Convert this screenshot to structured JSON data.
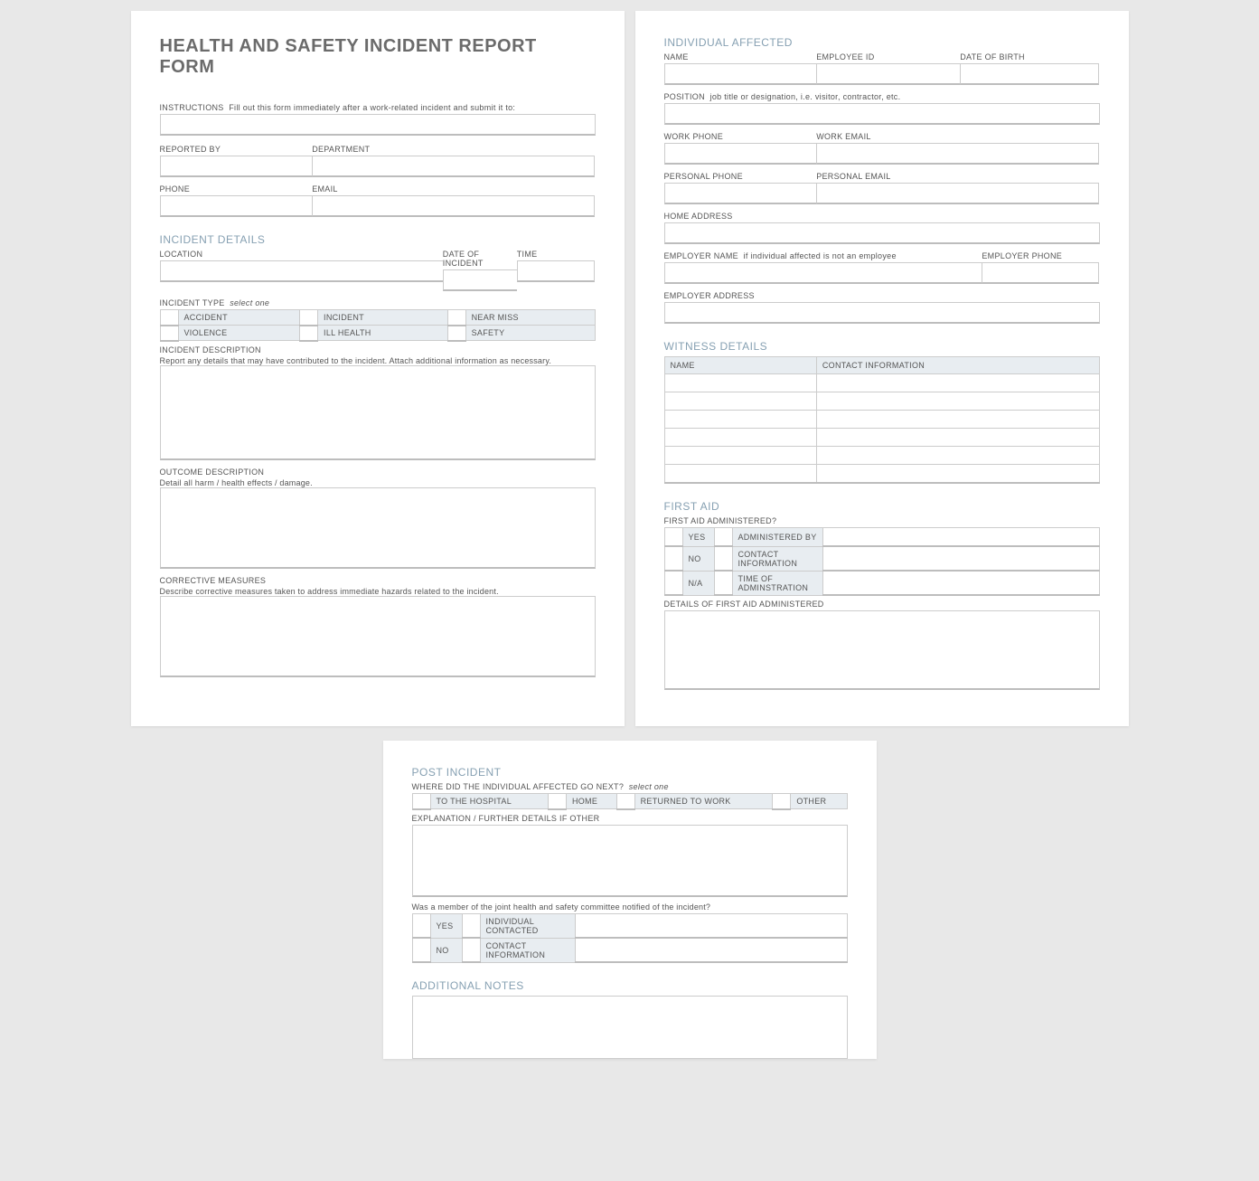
{
  "title": "HEALTH AND SAFETY INCIDENT REPORT FORM",
  "instructions": {
    "label": "INSTRUCTIONS",
    "hint": "Fill out this form immediately after a work-related incident and submit it to:"
  },
  "reporter": {
    "reported_by": "REPORTED BY",
    "department": "DEPARTMENT",
    "phone": "PHONE",
    "email": "EMAIL"
  },
  "incident_details": {
    "heading": "INCIDENT DETAILS",
    "location": "LOCATION",
    "date": "DATE OF INCIDENT",
    "time": "TIME",
    "type_label": "INCIDENT TYPE",
    "type_hint": "select one",
    "types": [
      "ACCIDENT",
      "INCIDENT",
      "NEAR MISS",
      "VIOLENCE",
      "ILL HEALTH",
      "SAFETY"
    ],
    "desc_label": "INCIDENT DESCRIPTION",
    "desc_sub": "Report any details that may have contributed to the incident.  Attach additional information as necessary.",
    "outcome_label": "OUTCOME DESCRIPTION",
    "outcome_sub": "Detail all harm / health effects / damage.",
    "corrective_label": "CORRECTIVE MEASURES",
    "corrective_sub": "Describe corrective measures taken to address immediate hazards related to the incident."
  },
  "individual": {
    "heading": "INDIVIDUAL AFFECTED",
    "name": "NAME",
    "employee_id": "EMPLOYEE ID",
    "dob": "DATE OF BIRTH",
    "position_label": "POSITION",
    "position_hint": "job title or designation, i.e. visitor, contractor, etc.",
    "work_phone": "WORK PHONE",
    "work_email": "WORK EMAIL",
    "personal_phone": "PERSONAL PHONE",
    "personal_email": "PERSONAL EMAIL",
    "home_address": "HOME ADDRESS",
    "employer_name_label": "EMPLOYER NAME",
    "employer_name_hint": "if individual affected is not an employee",
    "employer_phone": "EMPLOYER PHONE",
    "employer_address": "EMPLOYER ADDRESS"
  },
  "witness": {
    "heading": "WITNESS DETAILS",
    "col_name": "NAME",
    "col_contact": "CONTACT INFORMATION"
  },
  "first_aid": {
    "heading": "FIRST AID",
    "admin_q": "FIRST AID ADMINISTERED?",
    "yes": "YES",
    "no": "NO",
    "na": "N/A",
    "by": "ADMINISTERED BY",
    "contact": "CONTACT INFORMATION",
    "time": "TIME OF ADMINSTRATION",
    "details_label": "DETAILS OF FIRST AID ADMINISTERED"
  },
  "post": {
    "heading": "POST INCIDENT",
    "where_q": "WHERE DID THE INDIVIDUAL AFFECTED GO NEXT?",
    "where_hint": "select one",
    "options": [
      "TO THE HOSPITAL",
      "HOME",
      "RETURNED TO WORK",
      "OTHER"
    ],
    "explain": "EXPLANATION / FURTHER DETAILS IF OTHER",
    "committee_q": "Was a member of the joint health and safety committee notified of the incident?",
    "yes": "YES",
    "no": "NO",
    "contacted": "INDIVIDUAL CONTACTED",
    "contact_info": "CONTACT INFORMATION"
  },
  "notes": {
    "heading": "ADDITIONAL NOTES"
  }
}
